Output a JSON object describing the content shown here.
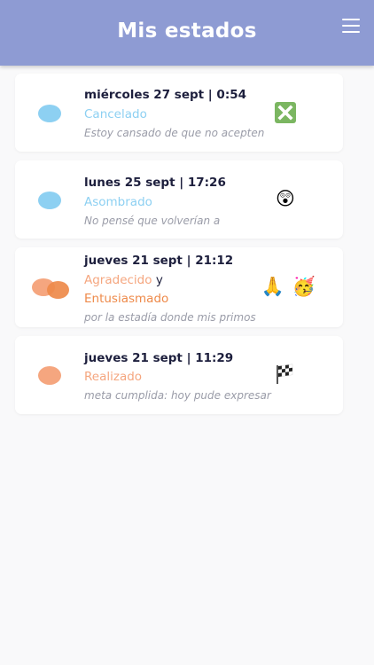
{
  "header": {
    "title": "Mis estados",
    "menu_icon": "hamburger-menu-icon"
  },
  "colors": {
    "header": "#8e9bd3",
    "sky_blue": "#8dd0f2",
    "peach": "#f5a67f",
    "orange": "#ee8a4a",
    "date_text": "#1d1f3d",
    "note_text": "#9a9ca8"
  },
  "entries": [
    {
      "date": "miércoles 27 sept | 0:54",
      "emotion": "Cancelado",
      "note": "Estoy cansado de que no acepten",
      "icons": [
        "cross-mark-button-icon"
      ]
    },
    {
      "date": "lunes 25 sept | 17:26",
      "emotion": "Asombrado",
      "note": "No pensé que volverían a",
      "icons": [
        "astonished-face-icon"
      ]
    },
    {
      "date": "jueves 21 sept | 21:12",
      "emotion": "Agradecido",
      "conjunction": "y",
      "emotion2": "Entusiasmado",
      "note": "por la estadía donde mis primos",
      "icons": [
        "folded-hands-icon",
        "partying-face-icon"
      ]
    },
    {
      "date": "jueves 21 sept | 11:29",
      "emotion": "Realizado",
      "note": "meta cumplida: hoy pude expresar",
      "icons": [
        "chequered-flag-icon"
      ]
    }
  ]
}
